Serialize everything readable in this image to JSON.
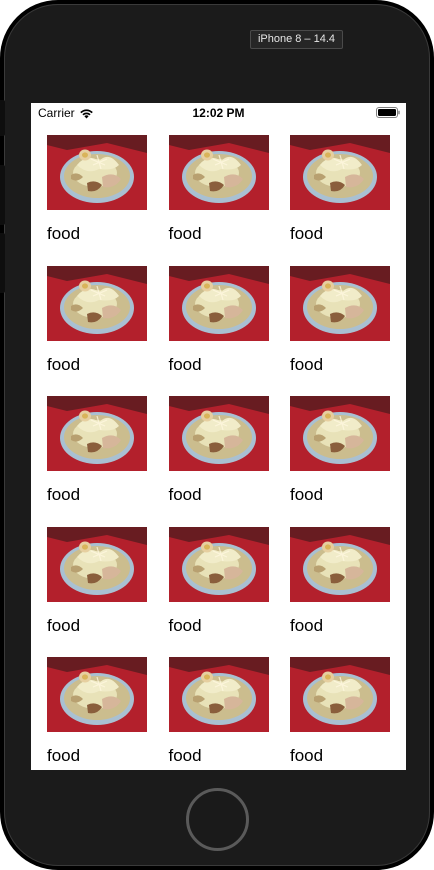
{
  "simulator": {
    "label": "iPhone 8 – 14.4"
  },
  "status_bar": {
    "carrier": "Carrier",
    "time": "12:02 PM",
    "wifi_icon": "wifi-icon",
    "battery_icon": "battery-icon"
  },
  "collection": {
    "items": [
      {
        "label": "food"
      },
      {
        "label": "food"
      },
      {
        "label": "food"
      },
      {
        "label": "food"
      },
      {
        "label": "food"
      },
      {
        "label": "food"
      },
      {
        "label": "food"
      },
      {
        "label": "food"
      },
      {
        "label": "food"
      },
      {
        "label": "food"
      },
      {
        "label": "food"
      },
      {
        "label": "food"
      },
      {
        "label": "food"
      },
      {
        "label": "food"
      },
      {
        "label": "food"
      }
    ]
  },
  "colors": {
    "photo_background": "#b3202c",
    "bowl_rim": "#9fb3c4",
    "broth": "#c9b98a"
  }
}
